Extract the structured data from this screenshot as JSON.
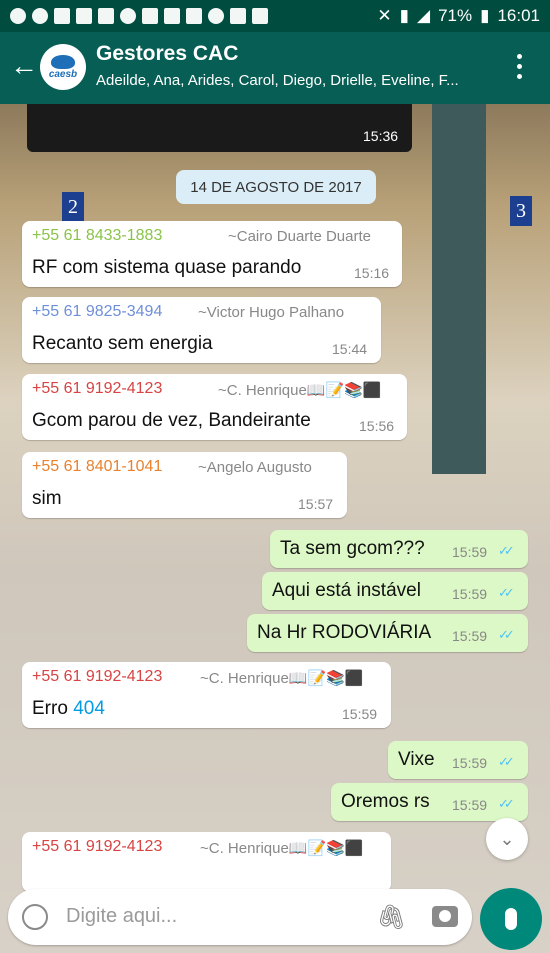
{
  "status_bar": {
    "battery": "71%",
    "time": "16:01"
  },
  "header": {
    "avatar_text": "caesb",
    "title": "Gestores CAC",
    "subtitle": "Adeilde, Ana, Arides, Carol, Diego, Drielle, Eveline, F..."
  },
  "chat": {
    "top_media_time": "15:36",
    "date_divider": "14 DE AGOSTO DE 2017",
    "messages": [
      {
        "phone": "+55 61 8433-1883",
        "name": "~Cairo Duarte Duarte",
        "text": "RF com sistema quase parando",
        "time": "15:16",
        "phone_color": "#8bc34a"
      },
      {
        "phone": "+55 61 9825-3494",
        "name": "~Victor Hugo Palhano",
        "text": "Recanto sem energia",
        "time": "15:44",
        "phone_color": "#6f8fd8"
      },
      {
        "phone": "+55 61 9192-4123",
        "name": "~C. Henrique📖📝📚⬛",
        "text": "Gcom parou de vez, Bandeirante",
        "time": "15:56",
        "phone_color": "#d84343"
      },
      {
        "phone": "+55 61 8401-1041",
        "name": "~Angelo Augusto",
        "text": "sim",
        "time": "15:57",
        "phone_color": "#e8812e"
      },
      {
        "text": "Ta sem gcom???",
        "time": "15:59"
      },
      {
        "text": "Aqui está instável",
        "time": "15:59"
      },
      {
        "text": "Na Hr RODOVIÁRIA",
        "time": "15:59"
      },
      {
        "phone": "+55 61 9192-4123",
        "name": "~C. Henrique📖📝📚⬛",
        "text_prefix": "Erro",
        "text_link": "404",
        "time": "15:59",
        "phone_color": "#d84343"
      },
      {
        "text": "Vixe",
        "time": "15:59"
      },
      {
        "text": "Oremos rs",
        "time": "15:59"
      },
      {
        "phone": "+55 61 9192-4123",
        "name": "~C. Henrique📖📝📚⬛",
        "phone_color": "#d84343"
      }
    ]
  },
  "input": {
    "placeholder": "Digite aqui..."
  }
}
